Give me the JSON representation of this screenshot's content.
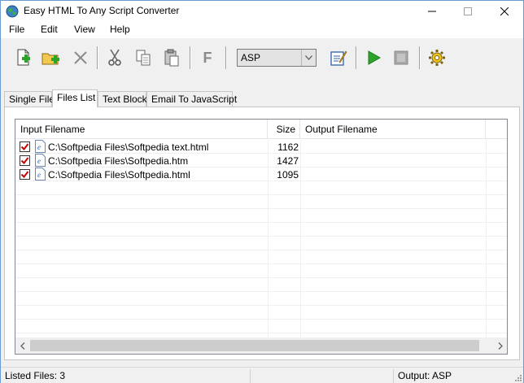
{
  "window": {
    "title": "Easy HTML To Any Script Converter"
  },
  "menu": [
    "File",
    "Edit",
    "View",
    "Help"
  ],
  "toolbar": {
    "buttons": [
      "new-file-icon",
      "add-files-icon",
      "remove-icon",
      "cut-icon",
      "copy-icon",
      "paste-icon",
      "format-icon",
      "edit-script-icon",
      "start-convert-icon",
      "stop-icon",
      "settings-icon"
    ],
    "format_label": "F",
    "format_select_value": "ASP"
  },
  "tabs": [
    "Single File",
    "Files List",
    "Text Block",
    "Email To JavaScript"
  ],
  "active_tab": "Files List",
  "files_list": {
    "columns": [
      "Input Filename",
      "Size",
      "Output Filename"
    ],
    "rows": [
      {
        "checked": true,
        "input": "C:\\Softpedia Files\\Softpedia text.html",
        "size": "1162",
        "output": ""
      },
      {
        "checked": true,
        "input": "C:\\Softpedia Files\\Softpedia.htm",
        "size": "1427",
        "output": ""
      },
      {
        "checked": true,
        "input": "C:\\Softpedia Files\\Softpedia.html",
        "size": "1095",
        "output": ""
      }
    ]
  },
  "status": {
    "listed": "Listed Files: 3",
    "output": "Output: ASP"
  },
  "colors": {
    "accent_green": "#2aa52a",
    "check_red": "#c80000",
    "window_border": "#6b9bd1"
  }
}
